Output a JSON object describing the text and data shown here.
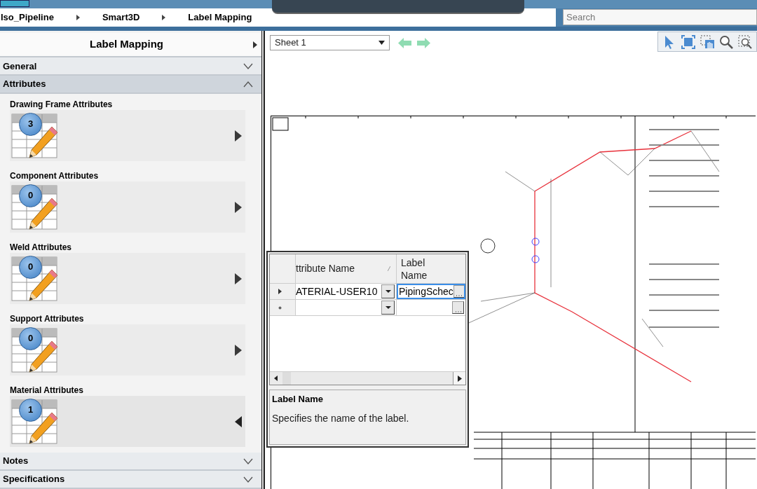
{
  "breadcrumb": [
    "Iso_Pipeline",
    "Smart3D",
    "Label Mapping"
  ],
  "search": {
    "placeholder": "Search"
  },
  "panel": {
    "title": "Label Mapping"
  },
  "sections_top": [
    {
      "label": "General",
      "expanded": false
    },
    {
      "label": "Attributes",
      "expanded": true
    }
  ],
  "attribute_groups": [
    {
      "title": "Drawing Frame Attributes",
      "count": "3",
      "selected": false
    },
    {
      "title": "Component Attributes",
      "count": "0",
      "selected": false
    },
    {
      "title": "Weld Attributes",
      "count": "0",
      "selected": false
    },
    {
      "title": "Support Attributes",
      "count": "0",
      "selected": false
    },
    {
      "title": "Material Attributes",
      "count": "1",
      "selected": true
    }
  ],
  "sections_bottom": [
    {
      "label": "Notes",
      "expanded": false
    },
    {
      "label": "Specifications",
      "expanded": false
    }
  ],
  "sheet": {
    "value": "Sheet 1"
  },
  "grid": {
    "columns": [
      "ttribute Name",
      "Label Name"
    ],
    "rows": [
      {
        "kind": "data",
        "selected": true,
        "attribute": "ATERIAL-USER10",
        "label": "PipingSchec"
      },
      {
        "kind": "new",
        "selected": false
      }
    ],
    "description": {
      "title": "Label Name",
      "text": "Specifies the name of the label."
    }
  }
}
